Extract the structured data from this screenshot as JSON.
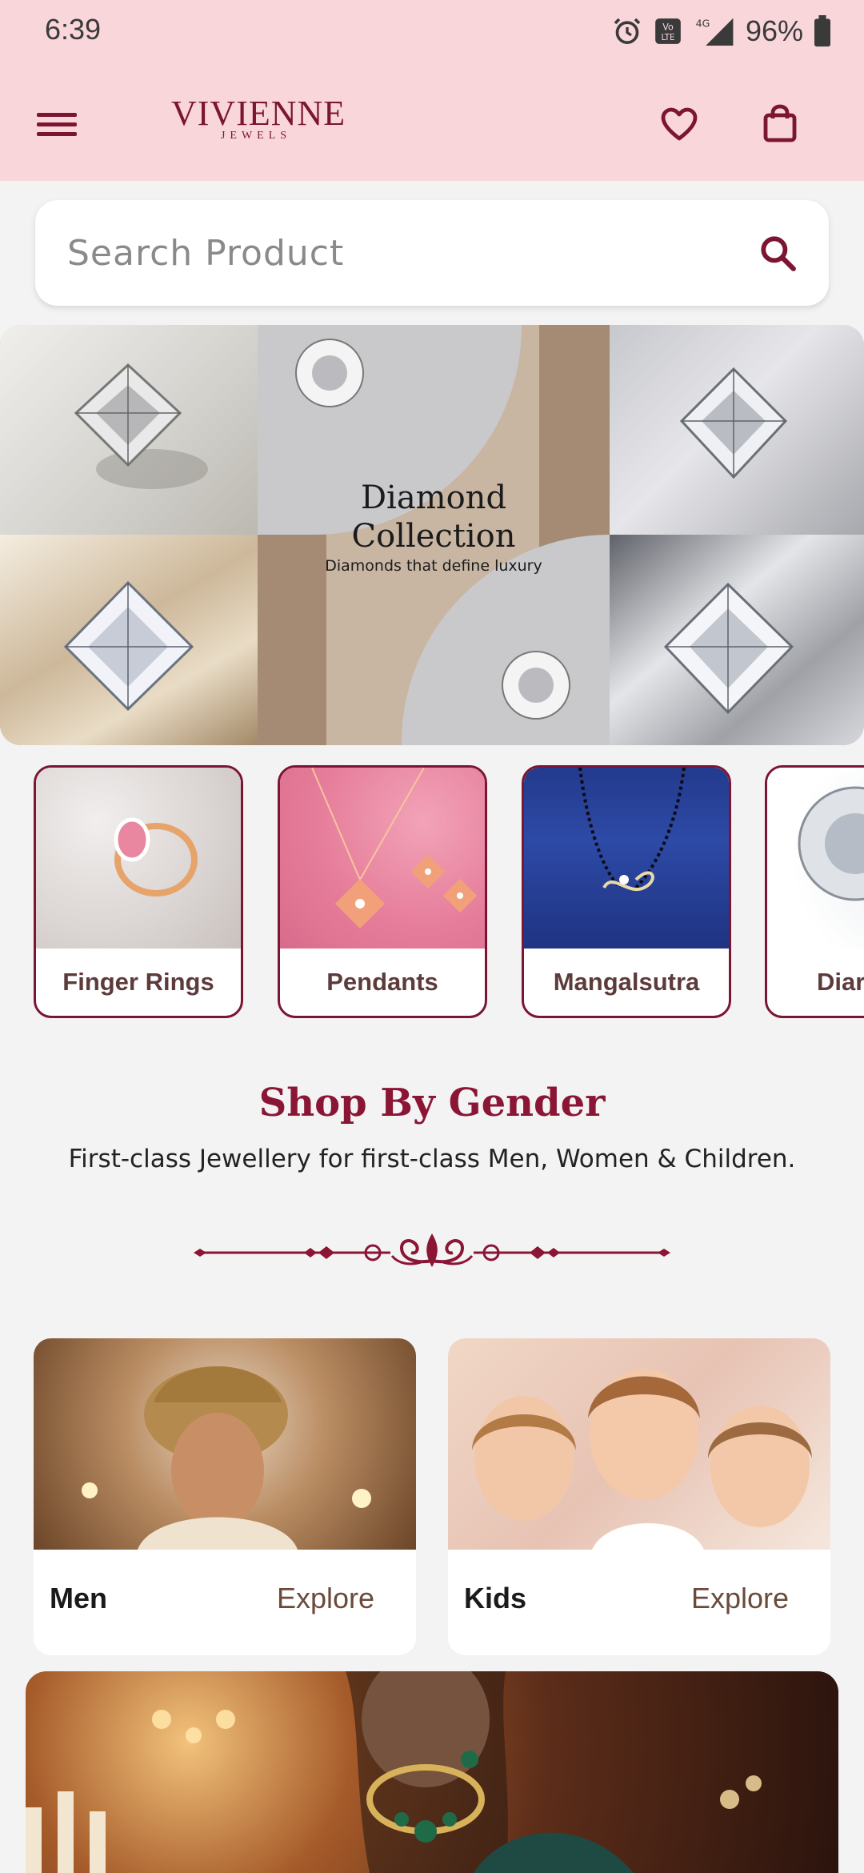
{
  "status_bar": {
    "time": "6:39",
    "battery": "96%",
    "network": "4G"
  },
  "header": {
    "brand": "VIVIENNE",
    "brand_sub": "JEWELS"
  },
  "search": {
    "placeholder": "Search Product"
  },
  "banner": {
    "title_line1": "Diamond",
    "title_line2": "Collection",
    "subtitle": "Diamonds that define luxury"
  },
  "categories": [
    {
      "label": "Finger Rings"
    },
    {
      "label": "Pendants"
    },
    {
      "label": "Mangalsutra"
    },
    {
      "label": "Diar"
    }
  ],
  "shop_by_gender": {
    "title": "Shop By Gender",
    "subtitle": "First-class Jewellery for first-class Men, Women & Children.",
    "cards": [
      {
        "name": "Men",
        "action": "Explore"
      },
      {
        "name": "Kids",
        "action": "Explore"
      }
    ]
  },
  "colors": {
    "accent": "#7b1532",
    "topbar": "#f9d6da",
    "background": "#f4f3f4"
  }
}
